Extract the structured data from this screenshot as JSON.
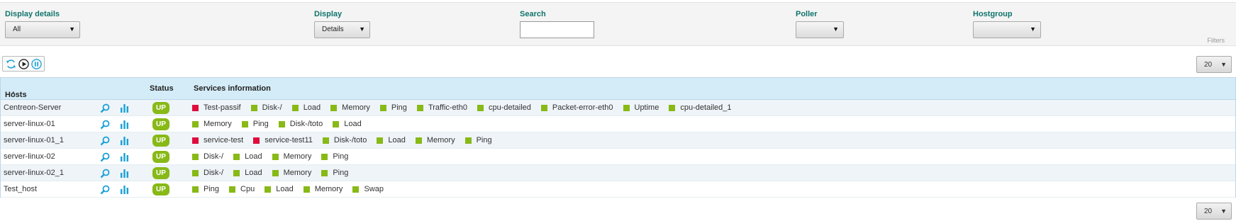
{
  "filters": {
    "display_details": {
      "label": "Display details",
      "value": "All"
    },
    "display": {
      "label": "Display",
      "value": "Details"
    },
    "search": {
      "label": "Search",
      "value": ""
    },
    "poller": {
      "label": "Poller",
      "value": ""
    },
    "hostgroup": {
      "label": "Hostgroup",
      "value": ""
    },
    "filters_link": "Filters"
  },
  "pagination": {
    "per_page": "20"
  },
  "table": {
    "headers": {
      "hosts": "Hosts",
      "status": "Status",
      "services": "Services information"
    },
    "sort_caret": "^",
    "rows": [
      {
        "host": "Centreon-Server",
        "status": "UP",
        "services": [
          {
            "name": "Test-passif",
            "state": "critical"
          },
          {
            "name": "Disk-/",
            "state": "ok"
          },
          {
            "name": "Load",
            "state": "ok"
          },
          {
            "name": "Memory",
            "state": "ok"
          },
          {
            "name": "Ping",
            "state": "ok"
          },
          {
            "name": "Traffic-eth0",
            "state": "ok"
          },
          {
            "name": "cpu-detailed",
            "state": "ok"
          },
          {
            "name": "Packet-error-eth0",
            "state": "ok"
          },
          {
            "name": "Uptime",
            "state": "ok"
          },
          {
            "name": "cpu-detailed_1",
            "state": "ok"
          }
        ]
      },
      {
        "host": "server-linux-01",
        "status": "UP",
        "services": [
          {
            "name": "Memory",
            "state": "ok"
          },
          {
            "name": "Ping",
            "state": "ok"
          },
          {
            "name": "Disk-/toto",
            "state": "ok"
          },
          {
            "name": "Load",
            "state": "ok"
          }
        ]
      },
      {
        "host": "server-linux-01_1",
        "status": "UP",
        "services": [
          {
            "name": "service-test",
            "state": "critical"
          },
          {
            "name": "service-test11",
            "state": "critical"
          },
          {
            "name": "Disk-/toto",
            "state": "ok"
          },
          {
            "name": "Load",
            "state": "ok"
          },
          {
            "name": "Memory",
            "state": "ok"
          },
          {
            "name": "Ping",
            "state": "ok"
          }
        ]
      },
      {
        "host": "server-linux-02",
        "status": "UP",
        "services": [
          {
            "name": "Disk-/",
            "state": "ok"
          },
          {
            "name": "Load",
            "state": "ok"
          },
          {
            "name": "Memory",
            "state": "ok"
          },
          {
            "name": "Ping",
            "state": "ok"
          }
        ]
      },
      {
        "host": "server-linux-02_1",
        "status": "UP",
        "services": [
          {
            "name": "Disk-/",
            "state": "ok"
          },
          {
            "name": "Load",
            "state": "ok"
          },
          {
            "name": "Memory",
            "state": "ok"
          },
          {
            "name": "Ping",
            "state": "ok"
          }
        ]
      },
      {
        "host": "Test_host",
        "status": "UP",
        "services": [
          {
            "name": "Ping",
            "state": "ok"
          },
          {
            "name": "Cpu",
            "state": "ok"
          },
          {
            "name": "Load",
            "state": "ok"
          },
          {
            "name": "Memory",
            "state": "ok"
          },
          {
            "name": "Swap",
            "state": "ok"
          }
        ]
      }
    ]
  },
  "icons": {
    "refresh": "refresh-icon",
    "play": "play-icon",
    "pause": "pause-icon",
    "zoom": "magnifier-icon",
    "graph": "bar-chart-icon"
  },
  "colors": {
    "accent": "#10746c",
    "ok": "#88b917",
    "critical": "#e00b3d",
    "header_bg": "#d4ecf7",
    "icon_blue": "#1aa1d6"
  }
}
